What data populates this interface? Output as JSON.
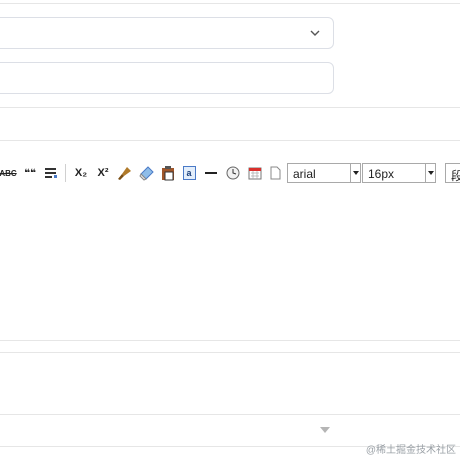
{
  "editor": {
    "font_family": "arial",
    "font_size": "16px",
    "paragraph_label": "段"
  },
  "toolbar": {
    "strike_label": "ABC",
    "quote_label": "❝❝",
    "subscript_label": "X₂",
    "superscript_label": "X²",
    "anchor_label": "a"
  },
  "watermark": "@稀土掘金技术社区",
  "colors": {
    "border": "#dcdfe6",
    "divider": "#e6e6e6"
  }
}
